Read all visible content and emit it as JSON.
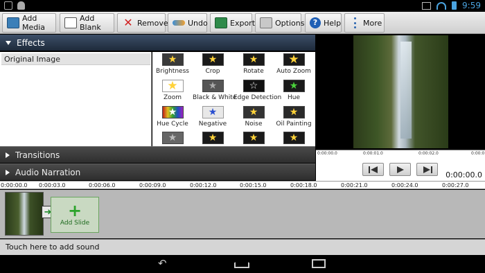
{
  "status": {
    "time": "9:59"
  },
  "toolbar": {
    "add_media": "Add Media",
    "add_blank": "Add Blank",
    "remove": "Remove",
    "undo": "Undo",
    "export": "Export",
    "options": "Options",
    "help": "Help",
    "more": "More"
  },
  "effects": {
    "title": "Effects",
    "list": [
      "Original Image"
    ],
    "items": [
      "Brightness",
      "Crop",
      "Rotate",
      "Auto Zoom",
      "Zoom",
      "Black & White",
      "Edge Detection",
      "Hue",
      "Hue Cycle",
      "Negative",
      "Noise",
      "Oil Painting"
    ]
  },
  "sections": {
    "transitions": "Transitions",
    "audio_narration": "Audio Narration"
  },
  "preview": {
    "ruler_labels": [
      "0:00:00.0",
      "0:00:01.0",
      "0:00:02.0",
      "0:00:0"
    ],
    "time": "0:00:00.0"
  },
  "timeline": {
    "ruler_labels": [
      "0:00:00.0",
      "0:00:03.0",
      "0:00:06.0",
      "0:00:09.0",
      "0:00:12.0",
      "0:00:15.0",
      "0:00:18.0",
      "0:00:21.0",
      "0:00:24.0",
      "0:00:27.0"
    ],
    "add_slide": "Add Slide"
  },
  "audio": {
    "hint": "Touch here to add sound"
  }
}
